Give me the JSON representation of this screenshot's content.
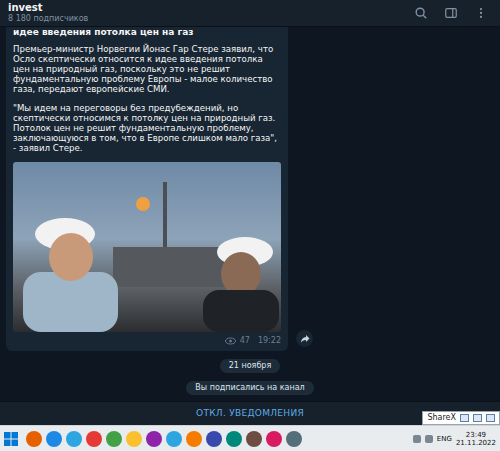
{
  "header": {
    "title": "invest",
    "subtitle": "8 180 подписчиков"
  },
  "message": {
    "heading": "идее введения потолка цен на газ",
    "body": "Премьер-министр Норвегии Йонас Гар Стере заявил, что Осло скептически относится к идее введения потолка цен на природный газ, поскольку это не решит фундаментальную проблему Европы - малое количество газа, передают европейские СМИ.",
    "quote": "\"Мы идем на переговоры без предубеждений, но скептически относимся к потолку цен на природный газ. Потолок цен не решит фундаментальную проблему, заключающуюся в том, что в Европе слишком мало газа\", - заявил Стере.",
    "views": "47",
    "time": "19:22"
  },
  "date_pill": "21 ноября",
  "service": "Вы подписались на канал",
  "bottom_button": "ОТКЛ. УВЕДОМЛЕНИЯ",
  "taskbar": {
    "apps": [
      {
        "color": "#e66000"
      },
      {
        "color": "#1e88e5"
      },
      {
        "color": "#2ca5e0"
      },
      {
        "color": "#e53935"
      },
      {
        "color": "#43a047"
      },
      {
        "color": "#fbc02d"
      },
      {
        "color": "#8e24aa"
      },
      {
        "color": "#2ca5e0"
      },
      {
        "color": "#f57c00"
      },
      {
        "color": "#3949ab"
      },
      {
        "color": "#00897b"
      },
      {
        "color": "#6d4c41"
      },
      {
        "color": "#d81b60"
      },
      {
        "color": "#546e7a"
      }
    ],
    "lang": "ENG",
    "time": "23:49",
    "date": "21.11.2022"
  },
  "sharex": {
    "label": "ShareX"
  }
}
